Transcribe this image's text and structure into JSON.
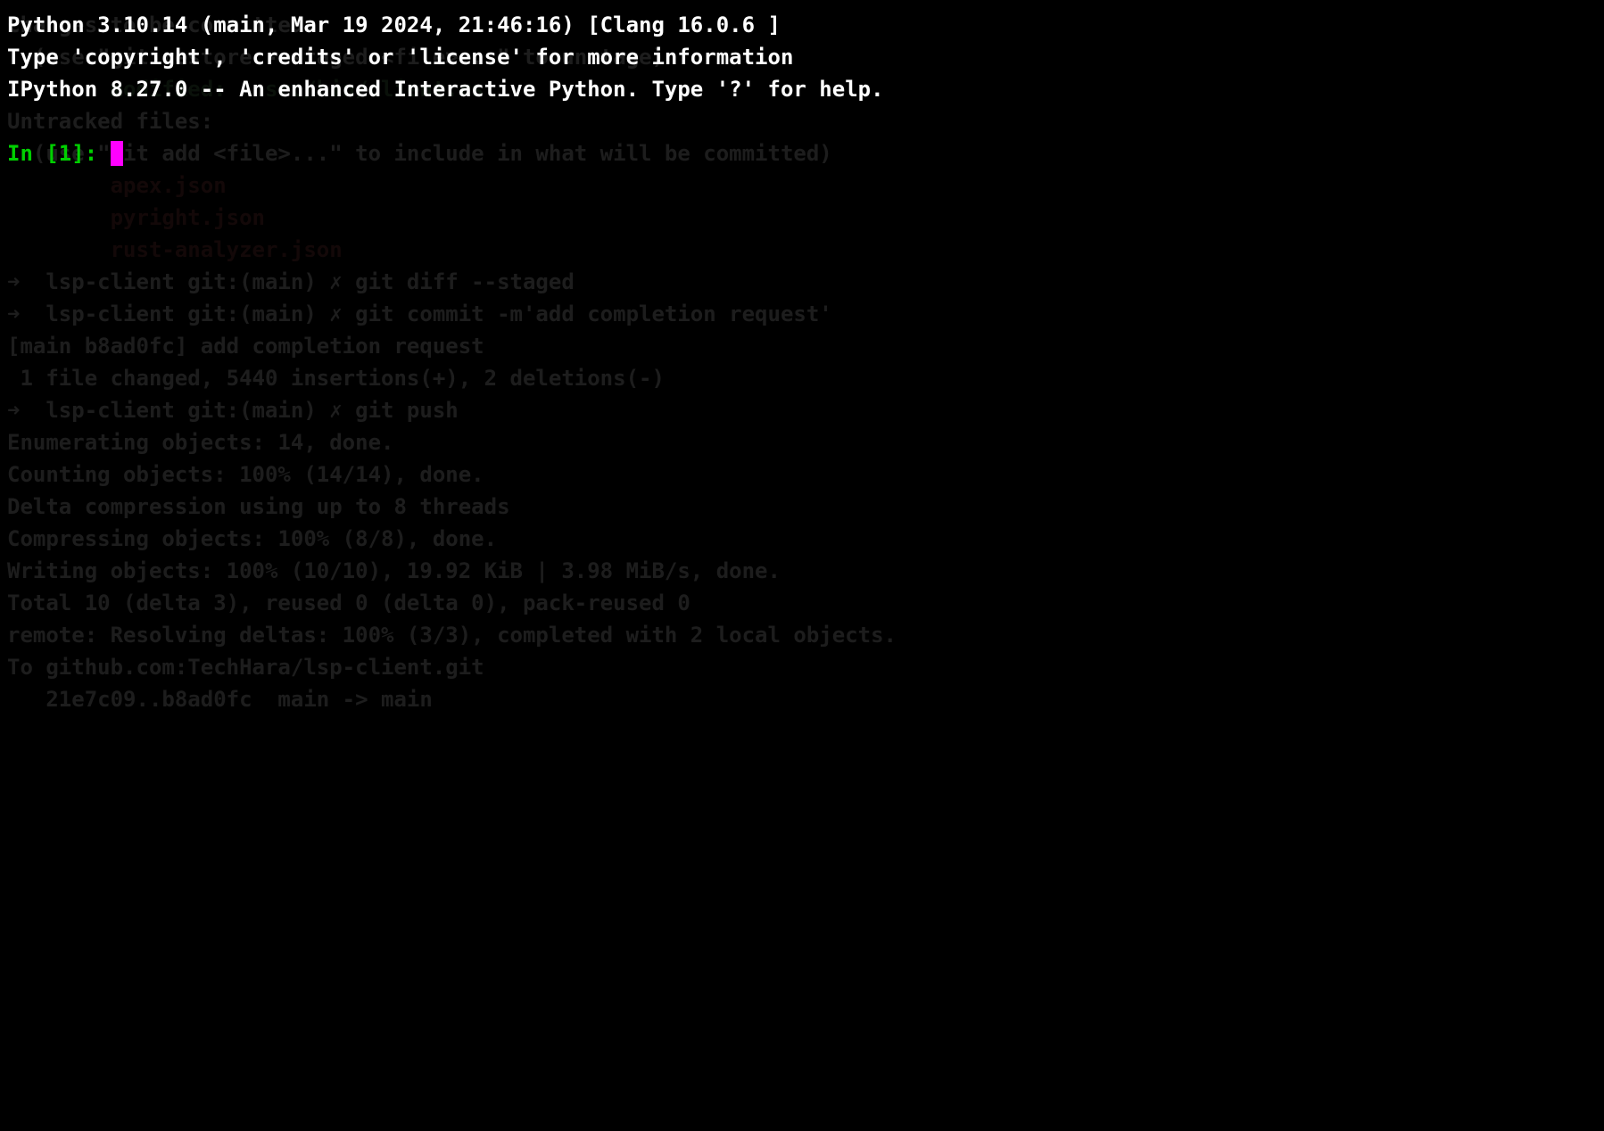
{
  "banner": {
    "line1": "Python 3.10.14 (main, Mar 19 2024, 21:46:16) [Clang 16.0.6 ]",
    "line2": "Type 'copyright', 'credits' or 'license' for more information",
    "line3": "IPython 8.27.0 -- An enhanced Interactive Python. Type '?' for help."
  },
  "prompt": {
    "label": "In [1]: "
  },
  "background": {
    "lines": [
      "",
      "Changes to be committed:",
      "  (use \"git restore --staged <file>...\" to unstage)",
      "        modified:   src/bin/client.rs",
      "",
      "Untracked files:",
      "  (use \"git add <file>...\" to include in what will be committed)",
      "        apex.json",
      "        pyright.json",
      "        rust-analyzer.json",
      "",
      "➜  lsp-client git:(main) ✗ git diff --staged",
      "➜  lsp-client git:(main) ✗ git commit -m'add completion request'",
      "[main b8ad0fc] add completion request",
      " 1 file changed, 5440 insertions(+), 2 deletions(-)",
      "➜  lsp-client git:(main) ✗ git push",
      "Enumerating objects: 14, done.",
      "Counting objects: 100% (14/14), done.",
      "Delta compression using up to 8 threads",
      "Compressing objects: 100% (8/8), done.",
      "Writing objects: 100% (10/10), 19.92 KiB | 3.98 MiB/s, done.",
      "Total 10 (delta 3), reused 0 (delta 0), pack-reused 0",
      "remote: Resolving deltas: 100% (3/3), completed with 2 local objects.",
      "To github.com:TechHara/lsp-client.git",
      "   21e7c09..b8ad0fc  main -> main"
    ]
  }
}
